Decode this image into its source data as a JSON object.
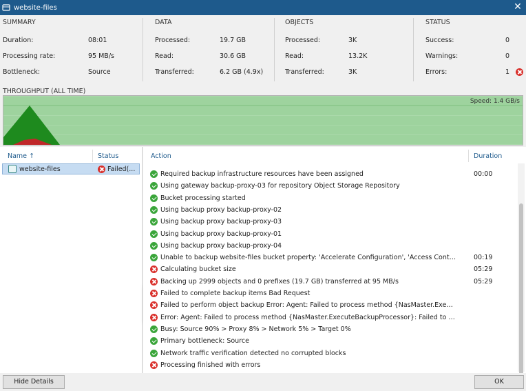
{
  "window": {
    "title": "website-files",
    "close_glyph": "✕"
  },
  "summary": {
    "heading": "SUMMARY",
    "rows": [
      {
        "label": "Duration:",
        "value": "08:01"
      },
      {
        "label": "Processing rate:",
        "value": "95 MB/s"
      },
      {
        "label": "Bottleneck:",
        "value": "Source"
      }
    ]
  },
  "data": {
    "heading": "DATA",
    "rows": [
      {
        "label": "Processed:",
        "value": "19.7 GB"
      },
      {
        "label": "Read:",
        "value": "30.6 GB"
      },
      {
        "label": "Transferred:",
        "value": "6.2 GB (4.9x)"
      }
    ]
  },
  "objects": {
    "heading": "OBJECTS",
    "rows": [
      {
        "label": "Processed:",
        "value": "3K"
      },
      {
        "label": "Read:",
        "value": "13.2K"
      },
      {
        "label": "Transferred:",
        "value": "3K"
      }
    ]
  },
  "status": {
    "heading": "STATUS",
    "rows": [
      {
        "label": "Success:",
        "value": "0"
      },
      {
        "label": "Warnings:",
        "value": "0"
      },
      {
        "label": "Errors:",
        "value": "1"
      }
    ]
  },
  "throughput": {
    "label": "THROUGHPUT (ALL TIME)",
    "speed": "Speed: 1.4 GB/s"
  },
  "jobs": {
    "col_name": "Name",
    "col_sort_glyph": "↑",
    "col_status": "Status",
    "selected": {
      "name": "website-files",
      "status": "Failed(..."
    }
  },
  "log": {
    "col_action": "Action",
    "col_duration": "Duration",
    "entries": [
      {
        "status": "success",
        "text": "Required backup infrastructure resources have been assigned",
        "duration": "00:00"
      },
      {
        "status": "success",
        "text": "Using gateway backup-proxy-03 for repository Object Storage Repository",
        "duration": ""
      },
      {
        "status": "success",
        "text": "Bucket processing started",
        "duration": ""
      },
      {
        "status": "success",
        "text": "Using backup proxy backup-proxy-02",
        "duration": ""
      },
      {
        "status": "success",
        "text": "Using backup proxy backup-proxy-03",
        "duration": ""
      },
      {
        "status": "success",
        "text": "Using backup proxy backup-proxy-01",
        "duration": ""
      },
      {
        "status": "success",
        "text": "Using backup proxy backup-proxy-04",
        "duration": ""
      },
      {
        "status": "success",
        "text": "Unable to backup website-files bucket property: 'Accelerate Configuration', 'Access Control List',...",
        "duration": "00:19"
      },
      {
        "status": "error",
        "text": "Calculating bucket size",
        "duration": "05:29"
      },
      {
        "status": "error",
        "text": "Backing up 2999 objects and 0 prefixes (19.7 GB) transferred at 95 MB/s",
        "duration": "05:29"
      },
      {
        "status": "error",
        "text": "Failed to complete backup items Bad Request",
        "duration": ""
      },
      {
        "status": "error",
        "text": "Failed to perform object backup Error: Agent: Failed to process method {NasMaster.ExecuteBackupPr...",
        "duration": ""
      },
      {
        "status": "error",
        "text": "Error: Agent: Failed to process method {NasMaster.ExecuteBackupProcessor}: Failed to complete bac...",
        "duration": ""
      },
      {
        "status": "success",
        "text": "Busy: Source 90% > Proxy 8% > Network 5% > Target 0%",
        "duration": ""
      },
      {
        "status": "success",
        "text": "Primary bottleneck: Source",
        "duration": ""
      },
      {
        "status": "success",
        "text": "Network traffic verification detected no corrupted blocks",
        "duration": ""
      },
      {
        "status": "error",
        "text": "Processing finished with errors",
        "duration": ""
      }
    ]
  },
  "footer": {
    "hide_details": "Hide Details",
    "ok": "OK"
  },
  "colors": {
    "titlebar": "#1e5a8c",
    "chart_bg": "#9ed39e",
    "chart_peak": "#1e8a1e",
    "chart_read": "#c0282a",
    "error": "#d9302b",
    "success": "#3aa53a"
  }
}
